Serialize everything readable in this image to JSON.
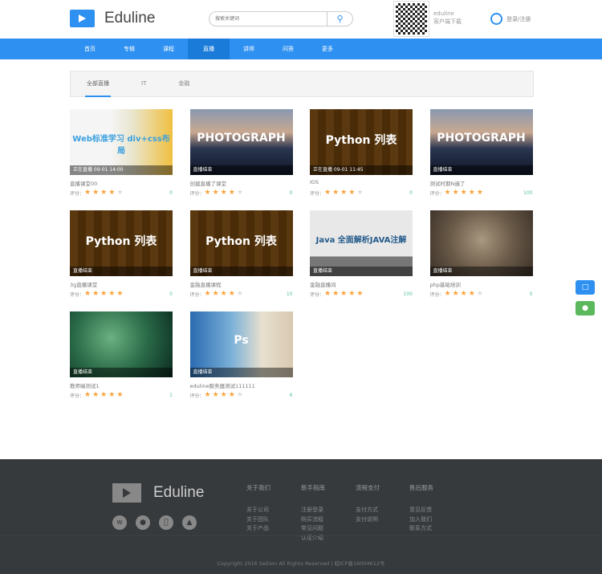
{
  "header": {
    "brand": "Eduline",
    "search_placeholder": "搜索关键词",
    "qr_title": "eduline",
    "qr_subtitle": "客户端下载",
    "login": "登录",
    "separator": "/",
    "register": "注册"
  },
  "nav": [
    "首页",
    "专辑",
    "课程",
    "直播",
    "讲师",
    "问答",
    "更多"
  ],
  "nav_active": 3,
  "tabs": [
    "全部直播",
    "IT",
    "金融"
  ],
  "rating_label": "评分：",
  "courses": [
    {
      "title": "直播课堂00",
      "status": "正在直播 09-01 14:00",
      "thumb_text": "Web标准学习 div+css布局",
      "stars": 4,
      "count": "0"
    },
    {
      "title": "创建直播了课堂",
      "status": "直播结束",
      "thumb_text": "PHOTOGRAPH",
      "stars": 4,
      "count": "0"
    },
    {
      "title": "IOS",
      "status": "正在直播 09-01 11:45",
      "thumb_text": "Python 列表",
      "stars": 4,
      "count": "0"
    },
    {
      "title": "测试时期N遍了",
      "status": "直播结束",
      "thumb_text": "PHOTOGRAPH",
      "stars": 5,
      "count": "100"
    },
    {
      "title": "3g直播课堂",
      "status": "直播结束",
      "thumb_text": "Python 列表",
      "stars": 5,
      "count": "0"
    },
    {
      "title": "金融直播课程",
      "status": "直播结束",
      "thumb_text": "Python 列表",
      "stars": 4,
      "count": "10"
    },
    {
      "title": "金融直播间",
      "status": "直播结束",
      "thumb_text": "Java 全面解析JAVA注解",
      "stars": 5,
      "count": "100"
    },
    {
      "title": "php基础培训",
      "status": "直播结束",
      "thumb_text": "",
      "stars": 4,
      "count": "0"
    },
    {
      "title": "教师端测试1",
      "status": "直播结束",
      "thumb_text": "",
      "stars": 5,
      "count": "1"
    },
    {
      "title": "eduline服务器测试111111",
      "status": "直播结束",
      "thumb_text": "Ps",
      "stars": 4,
      "count": "6"
    }
  ],
  "colors": {
    "accent": "#2e90f0",
    "star": "#f9a23b",
    "footer": "#363a3d"
  },
  "side_icons": [
    "chat-icon",
    "wechat-icon"
  ],
  "footer": {
    "brand": "Eduline",
    "social": [
      "weibo-icon",
      "wechat-icon",
      "apple-icon",
      "android-icon"
    ],
    "columns": [
      {
        "title": "关于我们",
        "links": [
          "关于公司",
          "关于团队",
          "关于产品"
        ]
      },
      {
        "title": "新手指南",
        "links": [
          "注册登录",
          "购买流程",
          "常见问题",
          "认证介绍"
        ]
      },
      {
        "title": "流程支付",
        "links": [
          "支付方式",
          "支付说明"
        ]
      },
      {
        "title": "售后服务",
        "links": [
          "意见反馈",
          "加入我们",
          "联系方式"
        ]
      }
    ],
    "copyright": "Copyright 2016 Seition All Rights Reserved | 皖ICP备16004612号"
  }
}
